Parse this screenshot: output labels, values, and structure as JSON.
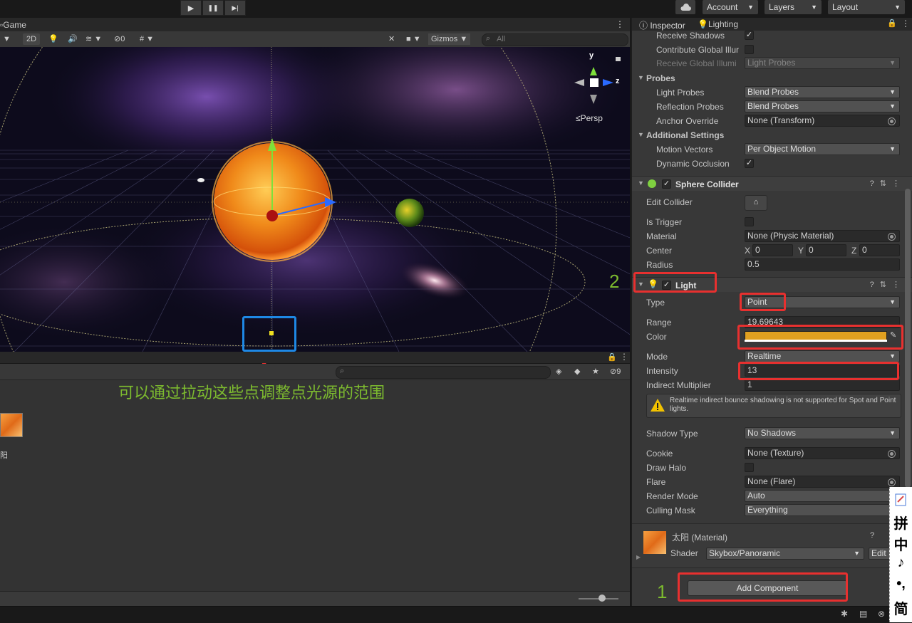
{
  "topbar": {
    "play": "▶",
    "pause": "❚❚",
    "step": "▶|",
    "account": "Account",
    "layers": "Layers",
    "layout": "Layout"
  },
  "scene": {
    "tab": "Game",
    "toolbar": {
      "mode2d": "2D",
      "hidden_count": "0",
      "gizmos": "Gizmos",
      "search_placeholder": "All"
    },
    "gizmo": {
      "y": "y",
      "z": "z",
      "persp": "Persp"
    },
    "annotation": "可以通过拉动这些点调整点光源的范围"
  },
  "project": {
    "hidden_count": "9",
    "asset_label": "阳"
  },
  "inspector": {
    "tab_inspector": "Inspector",
    "tab_lighting": "Lighting",
    "renderer": {
      "receive_shadows": "Receive Shadows",
      "contribute_gi": "Contribute Global Illur",
      "receive_gi": "Receive Global Illumi",
      "receive_gi_value": "Light Probes",
      "probes_header": "Probes",
      "light_probes": "Light Probes",
      "light_probes_value": "Blend Probes",
      "reflection_probes": "Reflection Probes",
      "reflection_probes_value": "Blend Probes",
      "anchor_override": "Anchor Override",
      "anchor_override_value": "None (Transform)",
      "additional_header": "Additional Settings",
      "motion_vectors": "Motion Vectors",
      "motion_vectors_value": "Per Object Motion",
      "dynamic_occlusion": "Dynamic Occlusion"
    },
    "collider": {
      "title": "Sphere Collider",
      "edit_collider": "Edit Collider",
      "is_trigger": "Is Trigger",
      "material": "Material",
      "material_value": "None (Physic Material)",
      "center": "Center",
      "cx": "X",
      "cx_v": "0",
      "cy": "Y",
      "cy_v": "0",
      "cz": "Z",
      "cz_v": "0",
      "radius": "Radius",
      "radius_value": "0.5"
    },
    "light": {
      "title": "Light",
      "type": "Type",
      "type_value": "Point",
      "range": "Range",
      "range_value": "19.69643",
      "color": "Color",
      "color_hex": "#e0a020",
      "mode": "Mode",
      "mode_value": "Realtime",
      "intensity": "Intensity",
      "intensity_value": "13",
      "indirect": "Indirect Multiplier",
      "indirect_value": "1",
      "warning": "Realtime indirect bounce shadowing is not supported for Spot and Point lights.",
      "shadow_type": "Shadow Type",
      "shadow_type_value": "No Shadows",
      "cookie": "Cookie",
      "cookie_value": "None (Texture)",
      "draw_halo": "Draw Halo",
      "flare": "Flare",
      "flare_value": "None (Flare)",
      "render_mode": "Render Mode",
      "render_mode_value": "Auto",
      "culling_mask": "Culling Mask",
      "culling_mask_value": "Everything"
    },
    "material": {
      "name": "太阳 (Material)",
      "shader": "Shader",
      "shader_value": "Skybox/Panoramic",
      "edit": "Edit"
    },
    "add_component": "Add Component"
  },
  "annotations": {
    "num1": "1",
    "num2": "2"
  },
  "ime": [
    "拼",
    "中",
    "♪",
    "•,",
    "简"
  ],
  "colors": {
    "annotation_green": "#7dbb2f",
    "highlight_red": "#e8302f",
    "highlight_blue": "#1e88e5"
  }
}
